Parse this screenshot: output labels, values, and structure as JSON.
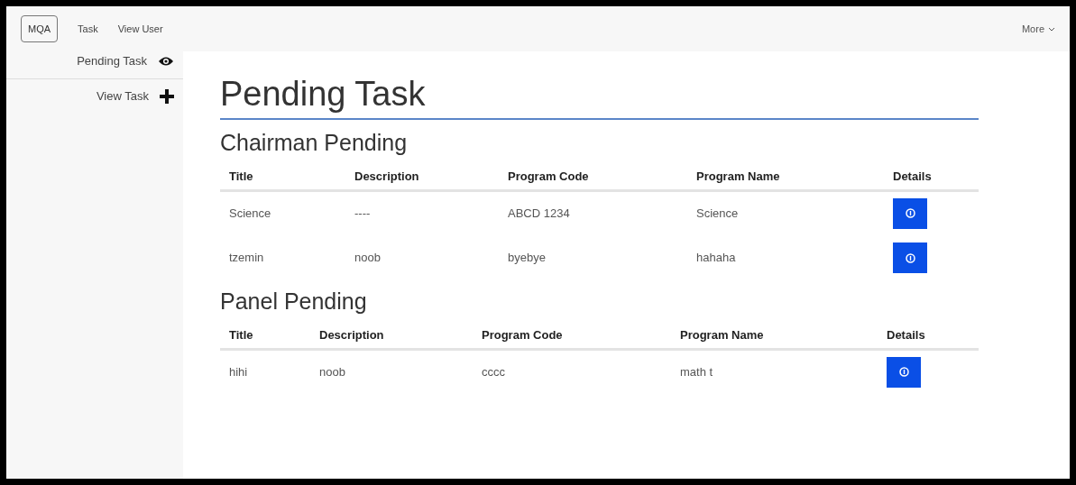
{
  "navbar": {
    "brand": "MQA",
    "links": [
      "Task",
      "View User"
    ],
    "more": {
      "label": "More"
    }
  },
  "sidebar": {
    "items": [
      {
        "label": "Pending Task",
        "kind": "view"
      },
      {
        "label": "View Task",
        "kind": "add"
      }
    ]
  },
  "page_title": "Pending Task",
  "sections": [
    {
      "title": "Chairman Pending",
      "columns": [
        "Title",
        "Description",
        "Program Code",
        "Program Name",
        "Details"
      ],
      "rows": [
        {
          "cells": [
            "Science",
            "----",
            "ABCD 1234",
            "Science"
          ]
        },
        {
          "cells": [
            "tzemin",
            "noob",
            "byebye",
            "hahaha"
          ]
        }
      ]
    },
    {
      "title": "Panel Pending",
      "columns": [
        "Title",
        "Description",
        "Program Code",
        "Program Name",
        "Details"
      ],
      "rows": [
        {
          "cells": [
            "hihi",
            "noob",
            "cccc",
            "math t"
          ]
        }
      ]
    }
  ]
}
